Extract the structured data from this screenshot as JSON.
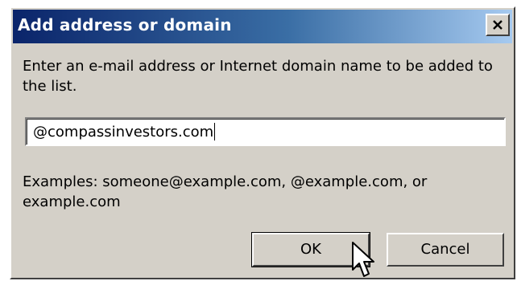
{
  "dialog": {
    "title": "Add address or domain",
    "close_icon": "close-icon",
    "prompt": "Enter an e-mail address or Internet domain name to be added to the list.",
    "input_value": "@compassinvestors.com",
    "examples": "Examples: someone@example.com, @example.com, or example.com",
    "ok_label": "OK",
    "cancel_label": "Cancel"
  },
  "cursor_icon": "mouse-pointer-icon",
  "colors": {
    "title_gradient_start": "#0a246a",
    "title_gradient_end": "#a6caf0",
    "dialog_face": "#d4d0c8"
  }
}
